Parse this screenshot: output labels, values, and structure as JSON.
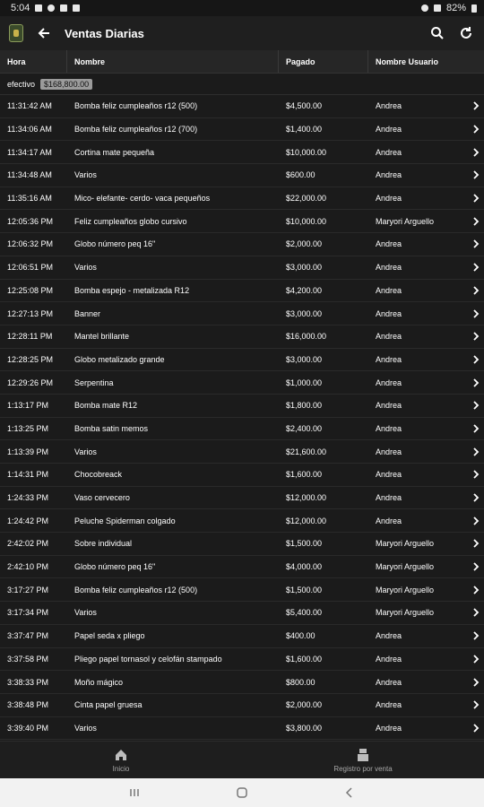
{
  "status_bar": {
    "time": "5:04",
    "battery": "82%"
  },
  "app_bar": {
    "title": "Ventas Diarias"
  },
  "table": {
    "headers": {
      "hora": "Hora",
      "nombre": "Nombre",
      "pagado": "Pagado",
      "usuario": "Nombre Usuario"
    },
    "group": {
      "label": "efectivo",
      "total": "$168,800.00"
    },
    "rows": [
      {
        "hora": "11:31:42 AM",
        "nombre": "Bomba feliz cumpleaños r12 (500)",
        "pagado": "$4,500.00",
        "usuario": "Andrea"
      },
      {
        "hora": "11:34:06 AM",
        "nombre": "Bomba feliz cumpleaños r12 (700)",
        "pagado": "$1,400.00",
        "usuario": "Andrea"
      },
      {
        "hora": "11:34:17 AM",
        "nombre": "Cortina mate pequeña",
        "pagado": "$10,000.00",
        "usuario": "Andrea"
      },
      {
        "hora": "11:34:48 AM",
        "nombre": "Varios",
        "pagado": "$600.00",
        "usuario": "Andrea"
      },
      {
        "hora": "11:35:16 AM",
        "nombre": "Mico- elefante- cerdo- vaca pequeños",
        "pagado": "$22,000.00",
        "usuario": "Andrea"
      },
      {
        "hora": "12:05:36 PM",
        "nombre": "Feliz cumpleaños globo cursivo",
        "pagado": "$10,000.00",
        "usuario": "Maryori Arguello"
      },
      {
        "hora": "12:06:32 PM",
        "nombre": "Globo número peq 16\"",
        "pagado": "$2,000.00",
        "usuario": "Andrea"
      },
      {
        "hora": "12:06:51 PM",
        "nombre": "Varios",
        "pagado": "$3,000.00",
        "usuario": "Andrea"
      },
      {
        "hora": "12:25:08 PM",
        "nombre": "Bomba espejo - metalizada R12",
        "pagado": "$4,200.00",
        "usuario": "Andrea"
      },
      {
        "hora": "12:27:13 PM",
        "nombre": "Banner",
        "pagado": "$3,000.00",
        "usuario": "Andrea"
      },
      {
        "hora": "12:28:11 PM",
        "nombre": "Mantel brillante",
        "pagado": "$16,000.00",
        "usuario": "Andrea"
      },
      {
        "hora": "12:28:25 PM",
        "nombre": "Globo metalizado grande",
        "pagado": "$3,000.00",
        "usuario": "Andrea"
      },
      {
        "hora": "12:29:26 PM",
        "nombre": "Serpentina",
        "pagado": "$1,000.00",
        "usuario": "Andrea"
      },
      {
        "hora": "1:13:17 PM",
        "nombre": "Bomba mate R12",
        "pagado": "$1,800.00",
        "usuario": "Andrea"
      },
      {
        "hora": "1:13:25 PM",
        "nombre": "Bomba satin memos",
        "pagado": "$2,400.00",
        "usuario": "Andrea"
      },
      {
        "hora": "1:13:39 PM",
        "nombre": "Varios",
        "pagado": "$21,600.00",
        "usuario": "Andrea"
      },
      {
        "hora": "1:14:31 PM",
        "nombre": "Chocobreack",
        "pagado": "$1,600.00",
        "usuario": "Andrea"
      },
      {
        "hora": "1:24:33 PM",
        "nombre": "Vaso cervecero",
        "pagado": "$12,000.00",
        "usuario": "Andrea"
      },
      {
        "hora": "1:24:42 PM",
        "nombre": "Peluche Spiderman colgado",
        "pagado": "$12,000.00",
        "usuario": "Andrea"
      },
      {
        "hora": "2:42:02 PM",
        "nombre": "Sobre individual",
        "pagado": "$1,500.00",
        "usuario": "Maryori Arguello"
      },
      {
        "hora": "2:42:10 PM",
        "nombre": "Globo número peq 16\"",
        "pagado": "$4,000.00",
        "usuario": "Maryori Arguello"
      },
      {
        "hora": "3:17:27 PM",
        "nombre": "Bomba feliz cumpleaños r12 (500)",
        "pagado": "$1,500.00",
        "usuario": "Maryori Arguello"
      },
      {
        "hora": "3:17:34 PM",
        "nombre": "Varios",
        "pagado": "$5,400.00",
        "usuario": "Maryori Arguello"
      },
      {
        "hora": "3:37:47 PM",
        "nombre": "Papel seda x pliego",
        "pagado": "$400.00",
        "usuario": "Andrea"
      },
      {
        "hora": "3:37:58 PM",
        "nombre": "Pliego papel tornasol y celofán stampado",
        "pagado": "$1,600.00",
        "usuario": "Andrea"
      },
      {
        "hora": "3:38:33 PM",
        "nombre": "Moño mágico",
        "pagado": "$800.00",
        "usuario": "Andrea"
      },
      {
        "hora": "3:38:48 PM",
        "nombre": "Cinta papel gruesa",
        "pagado": "$2,000.00",
        "usuario": "Andrea"
      },
      {
        "hora": "3:39:40 PM",
        "nombre": "Varios",
        "pagado": "$3,800.00",
        "usuario": "Andrea"
      }
    ]
  },
  "bottom_nav": {
    "home_label": "Inicio",
    "register_label": "Registro por venta"
  },
  "icons": {
    "back": "arrow-left-icon",
    "search": "search-icon",
    "refresh": "refresh-icon",
    "row_chevron": "chevron-right-icon",
    "home": "home-icon",
    "register": "register-icon"
  },
  "colors": {
    "background": "#1b1b1b",
    "header": "#262626",
    "badge": "#9b9b9b"
  }
}
